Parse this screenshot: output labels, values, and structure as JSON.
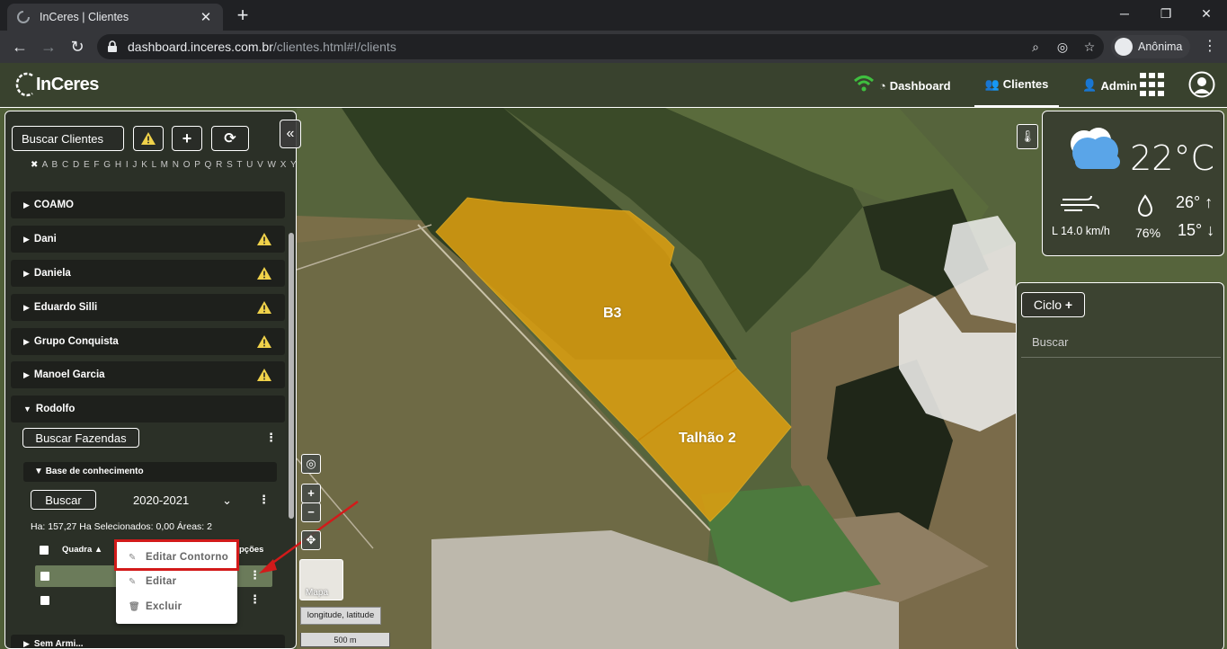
{
  "browser": {
    "tab_title": "InCeres | Clientes",
    "url_host": "dashboard.inceres.com.br",
    "url_path": "/clientes.html#!/clients",
    "profile_name": "Anônima"
  },
  "app": {
    "logo_text": "InCeres",
    "nav": {
      "dashboard": "Dashboard",
      "clientes": "Clientes",
      "admin": "Admin"
    }
  },
  "left_panel": {
    "search_clients": "Buscar Clientes",
    "alphabet": "A B C D E F G H I J K L M N O P Q R S T U V W X Y Z",
    "clients": [
      {
        "name": "COAMO",
        "warning": false
      },
      {
        "name": "Dani",
        "warning": true
      },
      {
        "name": "Daniela",
        "warning": true
      },
      {
        "name": "Eduardo Silli",
        "warning": true
      },
      {
        "name": "Grupo Conquista",
        "warning": true
      },
      {
        "name": "Manoel Garcia",
        "warning": true
      },
      {
        "name": "Rodolfo",
        "warning": false,
        "expanded": true
      }
    ],
    "search_farms": "Buscar Fazendas",
    "farm": "Base de conhecimento",
    "search_button": "Buscar",
    "season": "2020-2021",
    "stats": "Ha: 157,27    Ha Selecionados: 0,00    Áreas: 2",
    "table_headers": {
      "quadra": "Quadra",
      "opcoes": "pções"
    },
    "next_item_partial": "Sem Armi..."
  },
  "context_menu": {
    "items": [
      "Editar Contorno",
      "Editar",
      "Excluir"
    ]
  },
  "map": {
    "fields": [
      "B3",
      "Talhão 2"
    ],
    "thumb_label": "Mapa",
    "coordinates_label": "longitude, latitude",
    "scale_label": "500 m",
    "field_color": "#e0a010"
  },
  "weather": {
    "temperature": "22°C",
    "wind": "L 14.0 km/h",
    "humidity": "76%",
    "max_temp": "26°",
    "min_temp": "15°"
  },
  "right_panel": {
    "ciclo_label": "Ciclo",
    "search_placeholder": "Buscar"
  }
}
